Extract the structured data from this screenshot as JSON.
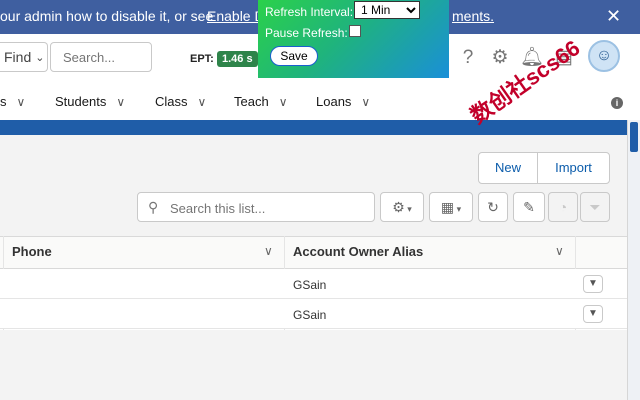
{
  "banner": {
    "text": "our admin how to disable it, or see",
    "link": "Enable D",
    "link_tail": "ments."
  },
  "header": {
    "find_label": "Find",
    "search_placeholder": "Search...",
    "ept_label": "EPT:",
    "ept_value": "1.46 s"
  },
  "popup": {
    "refresh_label": "Refresh Interval:",
    "refresh_value": "1 Min",
    "pause_label": "Pause Refresh:",
    "save_label": "Save"
  },
  "nav": {
    "items": [
      {
        "label": "s"
      },
      {
        "label": "Students"
      },
      {
        "label": "Class"
      },
      {
        "label": "Teach"
      },
      {
        "label": "Loans"
      }
    ]
  },
  "list": {
    "new_label": "New",
    "import_label": "Import",
    "search_placeholder": "Search this list...",
    "columns": [
      {
        "label": "Phone"
      },
      {
        "label": "Account Owner Alias"
      }
    ],
    "rows": [
      {
        "phone": "",
        "owner": "GSain"
      },
      {
        "phone": "",
        "owner": "GSain"
      }
    ]
  },
  "watermark": "数创社scs66",
  "colors": {
    "banner": "#3f5fa0",
    "ept_badge": "#2e844a",
    "brand_bar": "#1f5da8",
    "link": "#0b5cab",
    "watermark": "#c2002a"
  }
}
